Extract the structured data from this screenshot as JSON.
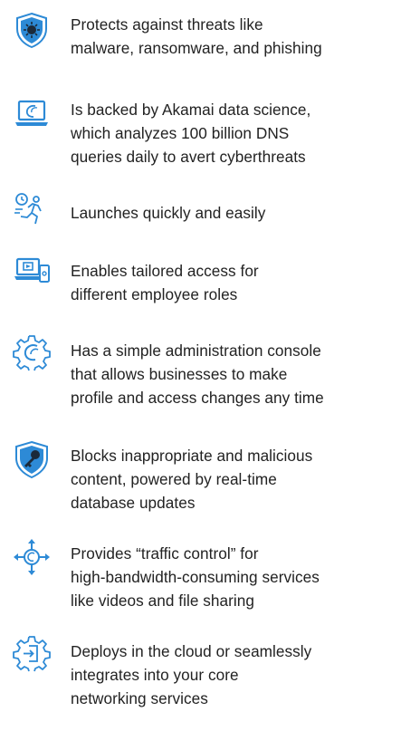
{
  "colors": {
    "accent": "#2d8ad6",
    "accent_dark": "#1c6fb5",
    "text": "#222222"
  },
  "benefits": [
    {
      "icon": "shield-virus-icon",
      "text": "Protects against threats like\nmalware, ransomware, and phishing"
    },
    {
      "icon": "laptop-akamai-icon",
      "text": "Is backed by Akamai data science,\nwhich analyzes 100 billion DNS\nqueries daily to avert cyberthreats"
    },
    {
      "icon": "running-clock-icon",
      "text": "Launches quickly and easily"
    },
    {
      "icon": "devices-access-icon",
      "text": "Enables tailored access for\ndifferent employee roles"
    },
    {
      "icon": "gear-console-icon",
      "text": "Has a simple administration console\nthat allows businesses to make\nprofile and access changes any time"
    },
    {
      "icon": "shield-key-icon",
      "text": "Blocks inappropriate and malicious\ncontent, powered by real-time\ndatabase updates"
    },
    {
      "icon": "traffic-arrows-icon",
      "text": "Provides “traffic control” for\nhigh-bandwidth-consuming services\nlike videos and file sharing"
    },
    {
      "icon": "gear-deploy-icon",
      "text": "Deploys in the cloud or seamlessly\nintegrates into your core\nnetworking services"
    }
  ]
}
